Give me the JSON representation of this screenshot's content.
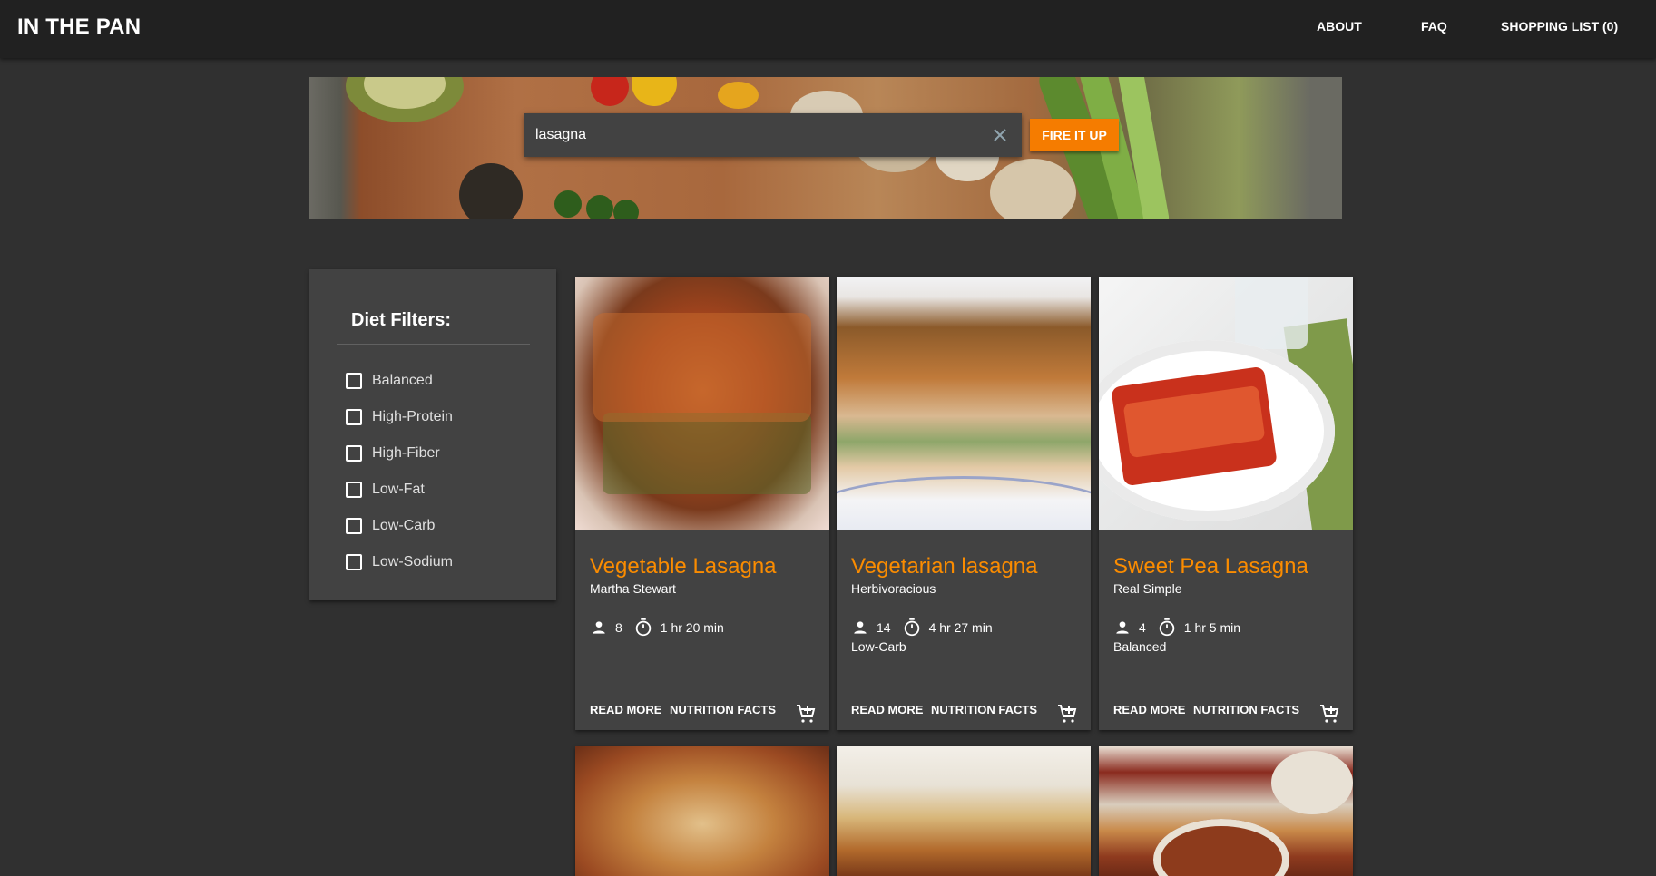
{
  "header": {
    "brand": "IN THE PAN",
    "nav": [
      "ABOUT",
      "FAQ",
      "SHOPPING LIST (0)"
    ]
  },
  "search": {
    "value": "lasagna",
    "button_label": "FIRE IT UP",
    "clear_icon": "close-icon"
  },
  "filters": {
    "title": "Diet Filters:",
    "items": [
      {
        "label": "Balanced",
        "checked": false
      },
      {
        "label": "High-Protein",
        "checked": false
      },
      {
        "label": "High-Fiber",
        "checked": false
      },
      {
        "label": "Low-Fat",
        "checked": false
      },
      {
        "label": "Low-Carb",
        "checked": false
      },
      {
        "label": "Low-Sodium",
        "checked": false
      }
    ]
  },
  "recipes": [
    {
      "title": "Vegetable Lasagna",
      "source": "Martha Stewart",
      "servings": "8",
      "time": "1 hr 20 min",
      "diet": ""
    },
    {
      "title": "Vegetarian lasagna",
      "source": "Herbivoracious",
      "servings": "14",
      "time": "4 hr 27 min",
      "diet": "Low-Carb"
    },
    {
      "title": "Sweet Pea Lasagna",
      "source": "Real Simple",
      "servings": "4",
      "time": "1 hr 5 min",
      "diet": "Balanced"
    }
  ],
  "card_actions": {
    "read_more": "READ MORE",
    "nutrition": "NUTRITION FACTS",
    "cart_icon": "add-shopping-cart-icon"
  },
  "colors": {
    "accent": "#f57c00",
    "title": "#fb8c00",
    "topbar": "#212121",
    "background": "#303030",
    "card": "#424242"
  }
}
